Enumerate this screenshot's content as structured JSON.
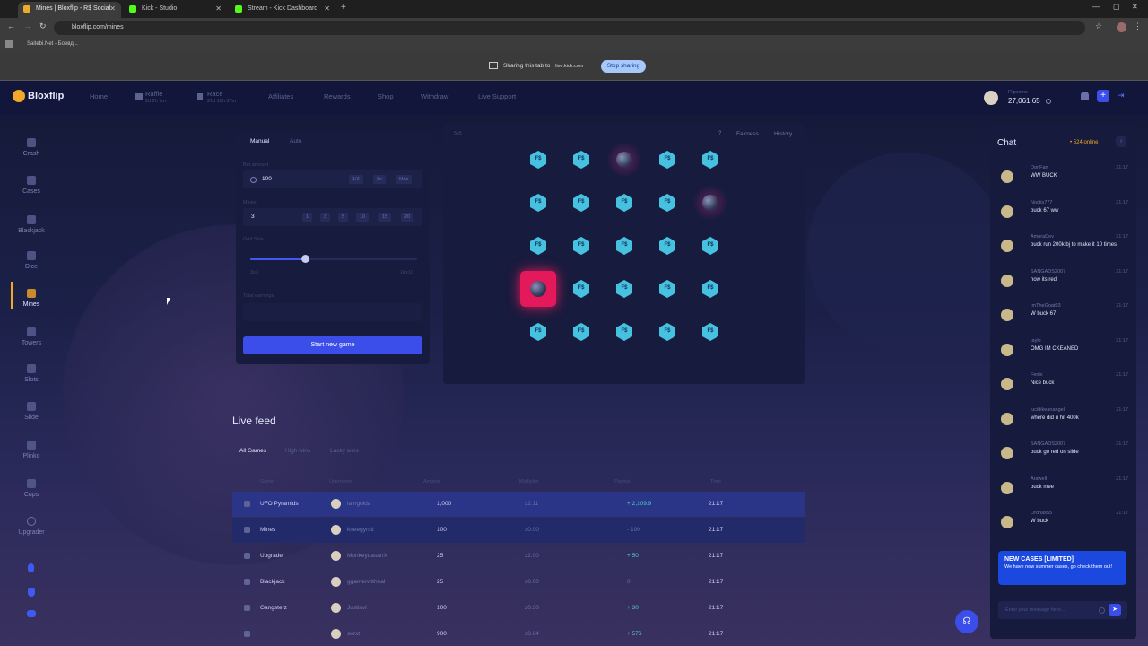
{
  "browser": {
    "tabs": [
      {
        "title": "Mines | Bloxflip - R$ Social"
      },
      {
        "title": "Kick - Studio"
      },
      {
        "title": "Stream - Kick Dashboard"
      }
    ],
    "url": "bloxflip.com/mines",
    "bookmark": "Saitebi.Net - Боевд..."
  },
  "sharing": {
    "text": "Sharing this tab to",
    "target": "live.kick.com",
    "stop_label": "Stop sharing"
  },
  "site": {
    "logo": "Bloxflip",
    "nav": {
      "home": "Home",
      "raffle": "Raffle",
      "raffle_timer": "2d 2h 7m",
      "race": "Race",
      "race_timer": "21d 10h 37m",
      "affiliates": "Affiliates",
      "rewards": "Rewards",
      "shop": "Shop",
      "withdraw": "Withdraw",
      "live_support": "Live Support"
    },
    "user": {
      "label": "Flipcoins",
      "balance": "27,061.65"
    }
  },
  "sidebar": {
    "items": [
      {
        "label": "Crash",
        "icon": "rocket-icon"
      },
      {
        "label": "Cases",
        "icon": "cases-icon"
      },
      {
        "label": "Blackjack",
        "icon": "cards-icon"
      },
      {
        "label": "Dice",
        "icon": "dice-icon"
      },
      {
        "label": "Mines",
        "icon": "mines-icon"
      },
      {
        "label": "Towers",
        "icon": "tower-icon"
      },
      {
        "label": "Slots",
        "icon": "slots-icon"
      },
      {
        "label": "Slide",
        "icon": "slide-icon"
      },
      {
        "label": "Plinko",
        "icon": "plinko-icon"
      },
      {
        "label": "Cups",
        "icon": "cups-icon"
      },
      {
        "label": "Upgrader",
        "icon": "upgrader-icon"
      }
    ],
    "active": "Mines"
  },
  "game": {
    "tabs": {
      "manual": "Manual",
      "auto": "Auto"
    },
    "bet_label": "Bet amount",
    "bet_value": "100",
    "bet_chips": [
      "1/2",
      "2x",
      "Max"
    ],
    "mines_label": "Mines",
    "mines_value": "3",
    "mines_chips": [
      "1",
      "3",
      "5",
      "10",
      "15",
      "20"
    ],
    "grid_label": "Grid Size",
    "grid_min": "3x3",
    "grid_max": "10x10",
    "grid_size_fraction": 0.33,
    "earnings_label": "Total earnings",
    "start_label": "Start new game",
    "board_size": "5x5",
    "help": "?",
    "fairness": "Fairness",
    "history": "History",
    "gem_text": "F$",
    "tiles": [
      "gem",
      "gem",
      "bomb",
      "gem",
      "gem",
      "gem",
      "gem",
      "gem",
      "gem",
      "bomb",
      "gem",
      "gem",
      "gem",
      "gem",
      "gem",
      "bomb-hit",
      "gem",
      "gem",
      "gem",
      "gem",
      "gem",
      "gem",
      "gem",
      "gem",
      "gem"
    ]
  },
  "feed": {
    "title": "Live feed",
    "tabs": [
      "All Games",
      "High wins",
      "Lucky wins"
    ],
    "headers": [
      "Game",
      "Username",
      "Amount",
      "Multiplier",
      "Payout",
      "Time"
    ],
    "rows": [
      {
        "game": "UFO Pyramids",
        "user": "iamgolda",
        "amount": "1,000",
        "mult": "x2.11",
        "payout": "+ 2,109.9",
        "time": "21:17"
      },
      {
        "game": "Mines",
        "user": "kneegyrsti",
        "amount": "100",
        "mult": "x0.00",
        "payout": "- 100",
        "time": "21:17"
      },
      {
        "game": "Upgrader",
        "user": "MonkeydasanX",
        "amount": "25",
        "mult": "x2.00",
        "payout": "+ 50",
        "time": "21:17"
      },
      {
        "game": "Blackjack",
        "user": "ggamerwitheal",
        "amount": "25",
        "mult": "x0.00",
        "payout": "0",
        "time": "21:17"
      },
      {
        "game": "Gangsterz",
        "user": "Justinvl",
        "amount": "100",
        "mult": "x0.30",
        "payout": "+ 30",
        "time": "21:17"
      },
      {
        "game": "",
        "user": "sorxt",
        "amount": "900",
        "mult": "x0.64",
        "payout": "+ 576",
        "time": "21:17"
      }
    ]
  },
  "chat": {
    "title": "Chat",
    "online": "• 524 online",
    "messages": [
      {
        "name": "DonFan",
        "text": "WW BUCK",
        "time": "21:17"
      },
      {
        "name": "Noctis777",
        "text": "buck 67 ww",
        "time": "21:17"
      },
      {
        "name": "AmuraDev",
        "text": "buck run 200k bj to make it 10 times",
        "time": "21:17"
      },
      {
        "name": "SANGADS2007",
        "text": "now its red",
        "time": "21:17"
      },
      {
        "name": "ImTheGoat03",
        "text": "W buck 67",
        "time": "21:17"
      },
      {
        "name": "taylo",
        "text": "OMG IM CKEANED",
        "time": "21:17"
      },
      {
        "name": "Fenix",
        "text": "Nice buck",
        "time": "21:17"
      },
      {
        "name": "lucidikeanangel",
        "text": "where did u hit 400k",
        "time": "21:17"
      },
      {
        "name": "SANGADS2007",
        "text": "buck go red on slide",
        "time": "21:17"
      },
      {
        "name": "Arawell",
        "text": "buck mee",
        "time": "21:17"
      },
      {
        "name": "Ordnas55",
        "text": "W buck",
        "time": "21:17"
      }
    ],
    "promo_title": "NEW CASES [LIMITED]",
    "promo_text": "We have new summer cases, go check them out!",
    "input_placeholder": "Enter your message here..."
  }
}
